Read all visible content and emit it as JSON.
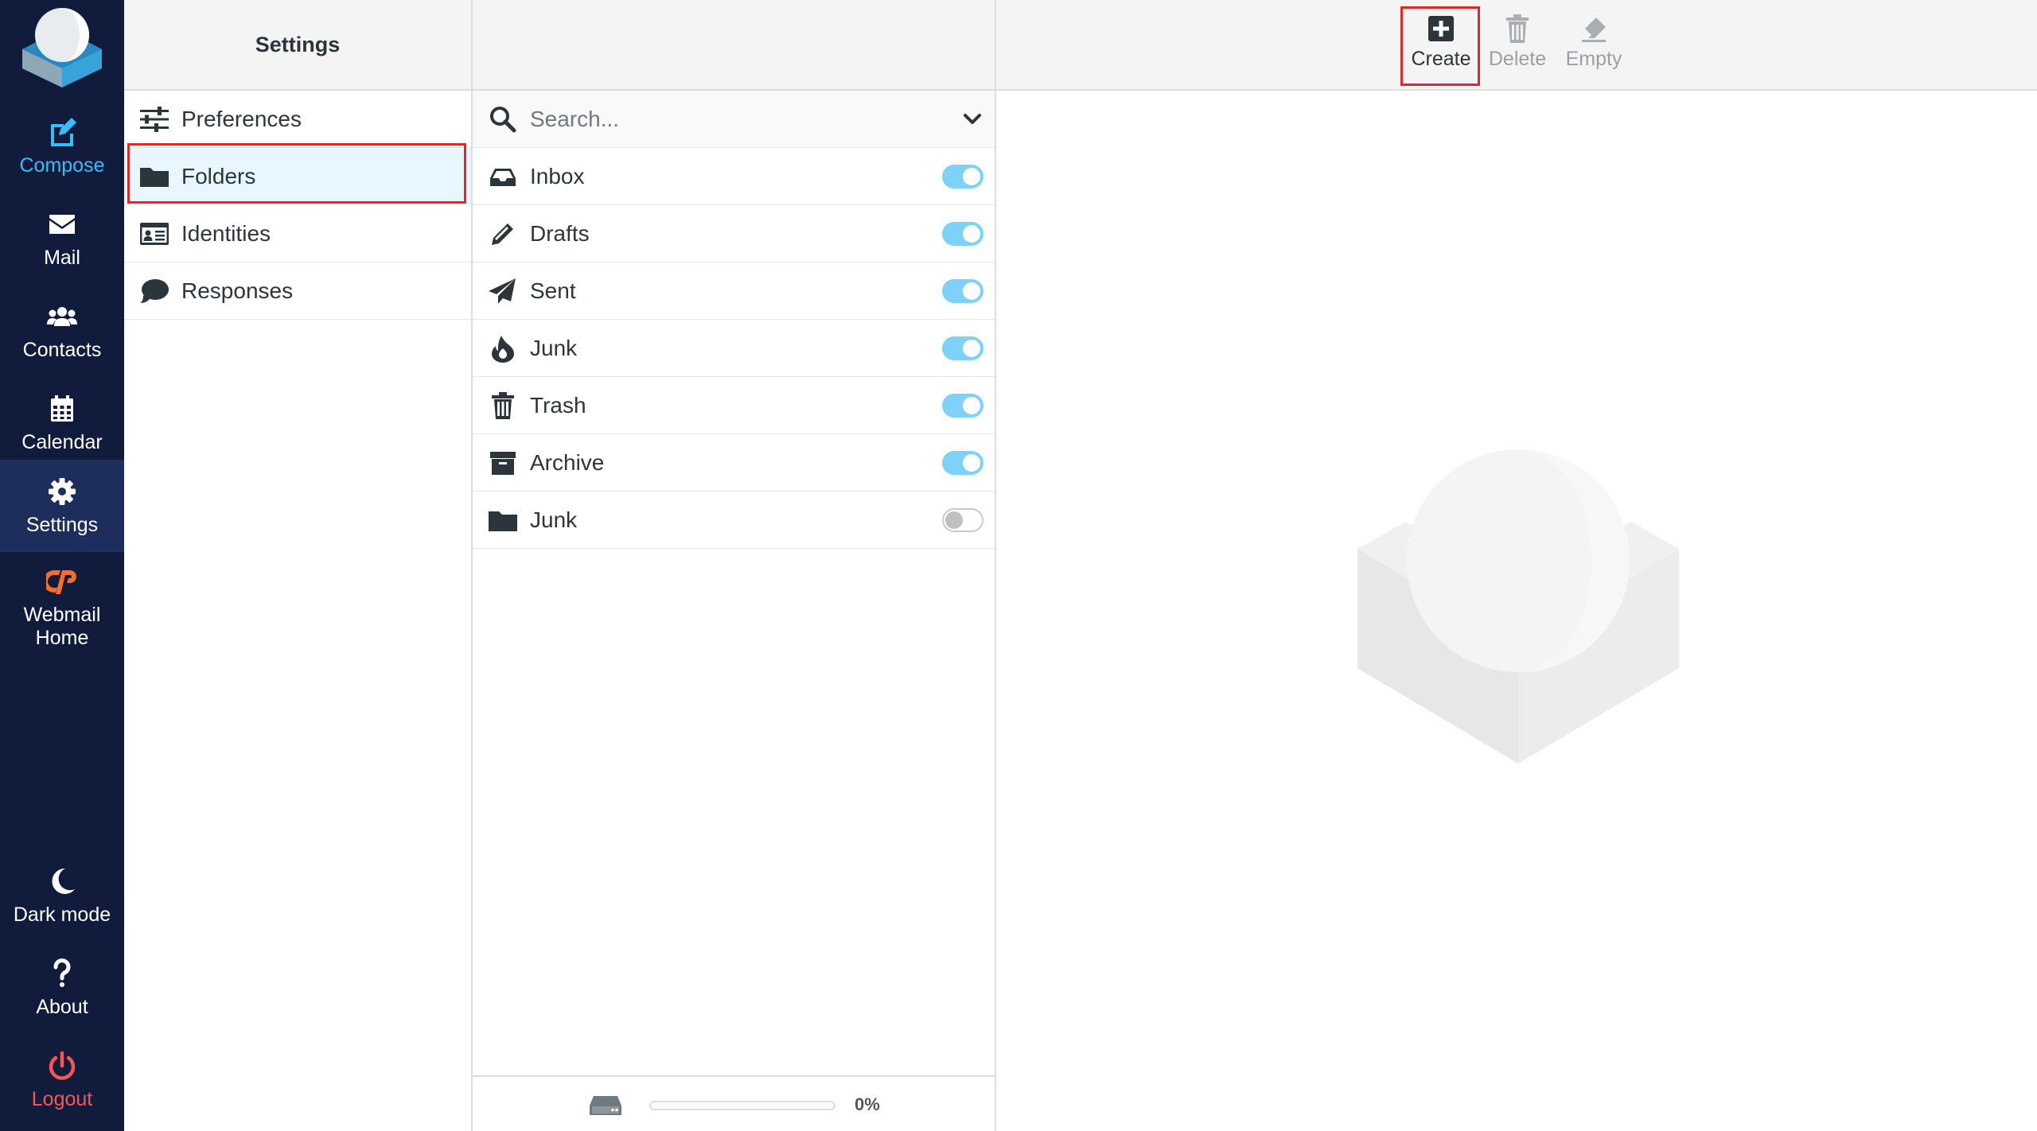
{
  "nav": {
    "compose": "Compose",
    "mail": "Mail",
    "contacts": "Contacts",
    "calendar": "Calendar",
    "settings": "Settings",
    "webmail_home": "Webmail Home",
    "dark_mode": "Dark mode",
    "about": "About",
    "logout": "Logout"
  },
  "settings_panel": {
    "title": "Settings",
    "items": [
      {
        "label": "Preferences",
        "icon": "sliders-icon"
      },
      {
        "label": "Folders",
        "icon": "folder-icon",
        "selected": true
      },
      {
        "label": "Identities",
        "icon": "id-card-icon"
      },
      {
        "label": "Responses",
        "icon": "comment-icon"
      }
    ]
  },
  "folders_panel": {
    "search_placeholder": "Search...",
    "folders": [
      {
        "label": "Inbox",
        "icon": "inbox-icon",
        "subscribed": true
      },
      {
        "label": "Drafts",
        "icon": "pencil-icon",
        "subscribed": true
      },
      {
        "label": "Sent",
        "icon": "paper-plane-icon",
        "subscribed": true
      },
      {
        "label": "Junk",
        "icon": "fire-icon",
        "subscribed": true
      },
      {
        "label": "Trash",
        "icon": "trash-icon",
        "subscribed": true
      },
      {
        "label": "Archive",
        "icon": "archive-icon",
        "subscribed": true
      },
      {
        "label": "Junk",
        "icon": "folder-icon",
        "subscribed": false
      }
    ],
    "quota_percent": "0%",
    "quota_fraction": 0
  },
  "toolbar": {
    "create": "Create",
    "delete": "Delete",
    "empty": "Empty"
  },
  "colors": {
    "rail_bg": "#111c3c",
    "accent": "#37beff",
    "logout": "#ff5552",
    "highlight": "#e0262b",
    "toggle_on": "#7ed2f8"
  }
}
